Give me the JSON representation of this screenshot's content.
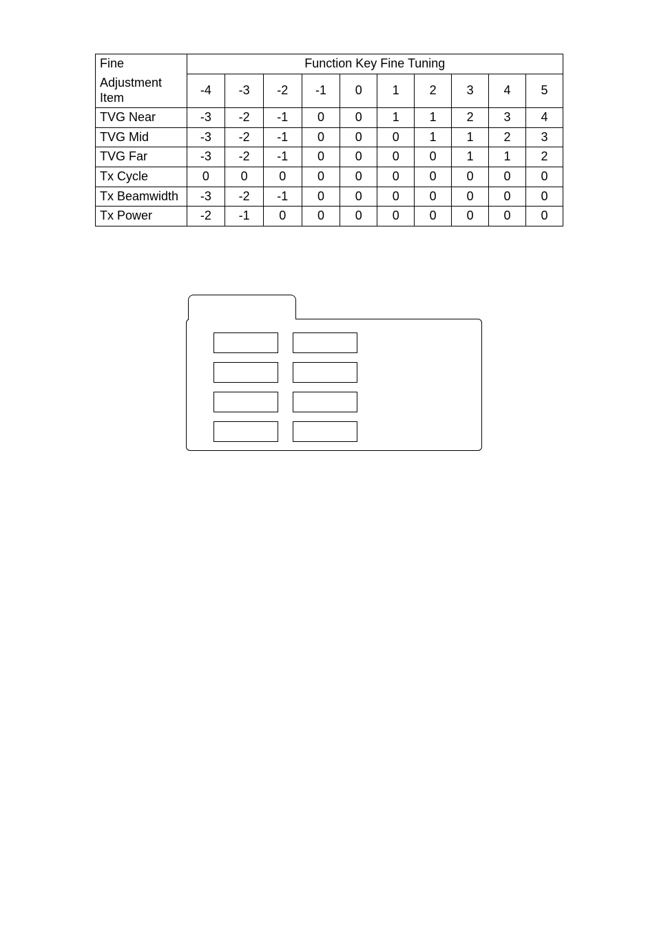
{
  "table": {
    "corner_label_top": "Fine",
    "corner_label_mid": "Adjustment",
    "corner_label_bot": "Item",
    "group_header": "Function Key Fine Tuning",
    "columns": [
      "-4",
      "-3",
      "-2",
      "-1",
      "0",
      "1",
      "2",
      "3",
      "4",
      "5"
    ],
    "rows": [
      {
        "label": "TVG Near",
        "values": [
          "-3",
          "-2",
          "-1",
          "0",
          "0",
          "1",
          "1",
          "2",
          "3",
          "4"
        ]
      },
      {
        "label": "TVG Mid",
        "values": [
          "-3",
          "-2",
          "-1",
          "0",
          "0",
          "0",
          "1",
          "1",
          "2",
          "3"
        ]
      },
      {
        "label": "TVG Far",
        "values": [
          "-3",
          "-2",
          "-1",
          "0",
          "0",
          "0",
          "0",
          "1",
          "1",
          "2"
        ]
      },
      {
        "label": "Tx Cycle",
        "values": [
          "0",
          "0",
          "0",
          "0",
          "0",
          "0",
          "0",
          "0",
          "0",
          "0"
        ]
      },
      {
        "label": "Tx Beamwidth",
        "values": [
          "-3",
          "-2",
          "-1",
          "0",
          "0",
          "0",
          "0",
          "0",
          "0",
          "0"
        ]
      },
      {
        "label": "Tx Power",
        "values": [
          "-2",
          "-1",
          "0",
          "0",
          "0",
          "0",
          "0",
          "0",
          "0",
          "0"
        ]
      }
    ]
  },
  "chart_data": {
    "type": "table",
    "title": "Function Key Fine Tuning",
    "columns": [
      "Fine Adjustment Item",
      "-4",
      "-3",
      "-2",
      "-1",
      "0",
      "1",
      "2",
      "3",
      "4",
      "5"
    ],
    "rows": [
      [
        "TVG Near",
        -3,
        -2,
        -1,
        0,
        0,
        1,
        1,
        2,
        3,
        4
      ],
      [
        "TVG Mid",
        -3,
        -2,
        -1,
        0,
        0,
        0,
        1,
        1,
        2,
        3
      ],
      [
        "TVG Far",
        -3,
        -2,
        -1,
        0,
        0,
        0,
        0,
        1,
        1,
        2
      ],
      [
        "Tx Cycle",
        0,
        0,
        0,
        0,
        0,
        0,
        0,
        0,
        0,
        0
      ],
      [
        "Tx Beamwidth",
        -3,
        -2,
        -1,
        0,
        0,
        0,
        0,
        0,
        0,
        0
      ],
      [
        "Tx Power",
        -2,
        -1,
        0,
        0,
        0,
        0,
        0,
        0,
        0,
        0
      ]
    ]
  }
}
